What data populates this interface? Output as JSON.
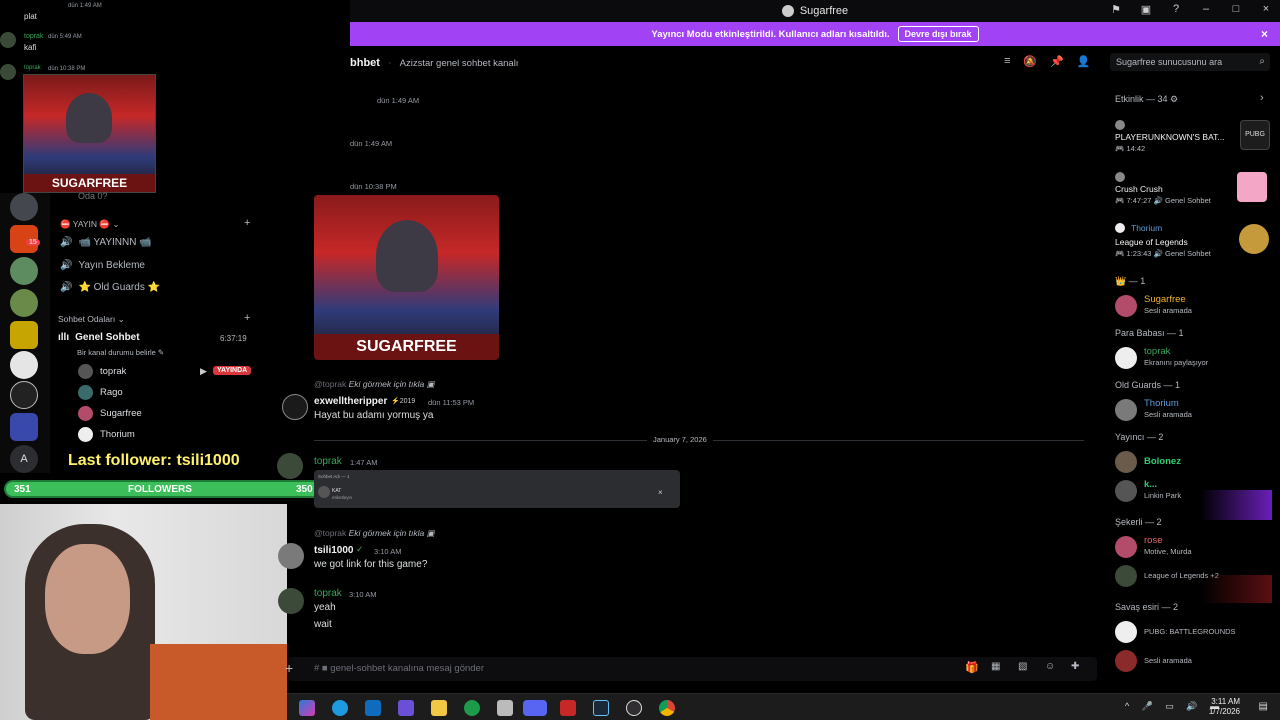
{
  "window": {
    "title": "Sugarfree"
  },
  "banner": {
    "text": "Yayıncı Modu etkinleştirildi. Kullanıcı adları kısaltıldı.",
    "button": "Devre dışı bırak"
  },
  "channel": {
    "name": "bhbet",
    "topic": "Azizstar genel sohbet kanalı"
  },
  "search": {
    "placeholder": "Sugarfree sunucusunu ara"
  },
  "overlay_chat": [
    {
      "time": "dün 1:49 AM",
      "text": "plat"
    },
    {
      "user": "toprak",
      "time": "dün 5:49 AM",
      "text": "kafi"
    },
    {
      "user": "toprak",
      "time": "dün 10:38 PM"
    }
  ],
  "overlay_cam_label": "SUGARFREE",
  "chat": {
    "stamps": [
      "dün 1:49 AM",
      "dün 1:49 AM",
      "dün 10:38 PM"
    ],
    "image_label": "SUGARFREE",
    "messages": [
      {
        "reply_user": "@toprak",
        "reply_text": "Eki görmek için tıkla",
        "user": "exwelltheripper",
        "badge": "2019",
        "time": "dün 11:53 PM",
        "text": "Hayat bu adamı yormuş ya"
      },
      {
        "user": "toprak",
        "time": "1:47 AM",
        "embed_small": "Sohbet Adı — 1",
        "embed_title": "KAT",
        "embed_sub": "etiketleyin"
      },
      {
        "reply_user": "@toprak",
        "reply_text": "Eki görmek için tıkla",
        "user": "tsili1000",
        "time": "3:10 AM",
        "text": "we got link  for this game?"
      },
      {
        "user": "toprak",
        "time": "3:10 AM",
        "text": "yeah",
        "text2": "wait"
      }
    ],
    "date_divider": "January 7, 2026",
    "composer_placeholder": "# ■ genel-sohbet kanalına mesaj gönder"
  },
  "sidebar": {
    "partial_channel": "Oda 0?",
    "category_yayin": "⛔ YAYIN ⛔",
    "channels": [
      "📹 YAYINNN 📹",
      "Yayın Bekleme",
      "⭐ Old Guards ⭐"
    ],
    "category_sohbet": "Sohbet Odaları",
    "voice_channel": "Genel Sohbet",
    "voice_time": "6:37:19",
    "voice_status": "Bir kanal durumu belirle",
    "voice_users": [
      "toprak",
      "Rago",
      "Sugarfree",
      "Thorium"
    ],
    "live_badge": "YAYINDA",
    "server_badge": "15",
    "server_letter": "A"
  },
  "stream_overlay": {
    "last_follower": "Last follower: tsili1000",
    "left_count": "351",
    "label": "FOLLOWERS",
    "right_count": "350"
  },
  "members": {
    "activity_header": "Etkinlik — 34",
    "activities": [
      {
        "title": "PLAYERUNKNOWN'S BAT...",
        "meta": "14:42",
        "color": "#1d1d1d",
        "icon": "PUBG"
      },
      {
        "title": "Crush Crush",
        "meta": "7:47:27",
        "loc": "Genel Sohbet",
        "color": "#f4a6c7",
        "icon": "crush-crush"
      },
      {
        "user": "Thorium",
        "title": "League of Legends",
        "meta": "1:23:43",
        "loc": "Genel Sohbet",
        "color": "#c49a3a",
        "icon": "league"
      }
    ],
    "groups": [
      {
        "header": "👑 — 1",
        "members": [
          {
            "name": "Sugarfree",
            "status": "Sesli aramada",
            "color": "#f0b232"
          }
        ]
      },
      {
        "header": "Para Babası — 1",
        "members": [
          {
            "name": "toprak",
            "status": "Ekranını paylaşıyor",
            "color": "#3ba55d"
          }
        ]
      },
      {
        "header": "Old Guards — 1",
        "members": [
          {
            "name": "Thorium",
            "status": "Sesli aramada",
            "color": "#5b9bd5"
          }
        ]
      },
      {
        "header": "Yayıncı — 2",
        "members": [
          {
            "name": "Bolonez",
            "status": "",
            "color": "#2ecc71"
          },
          {
            "name": "k...",
            "status": "Linkin Park",
            "color": "#2ecc71"
          }
        ]
      },
      {
        "header": "Şekerli — 2",
        "members": [
          {
            "name": "rose",
            "status": "Motive, Murda",
            "color": "#e06666"
          },
          {
            "name": "",
            "status": "League of Legends +2",
            "color": "#dbdee1"
          }
        ]
      },
      {
        "header": "Savaş esiri — 2",
        "members": [
          {
            "name": "",
            "status": "PUBG: BATTLEGROUNDS",
            "color": "#dbdee1"
          },
          {
            "name": "",
            "status": "Sesli aramada",
            "color": "#dbdee1"
          }
        ]
      }
    ]
  },
  "taskbar": {
    "time": "3:11 AM",
    "date": "1/7/2026"
  }
}
